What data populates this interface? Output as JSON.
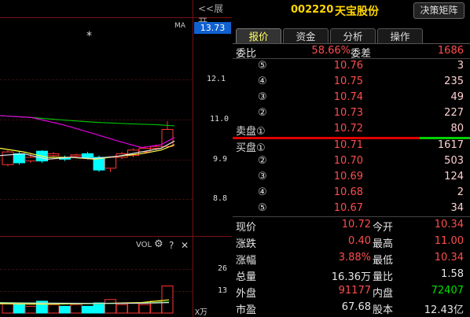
{
  "header": {
    "expand_label": "<<展开",
    "stock_code": "002220",
    "stock_name": "天宝股份",
    "decision_button": "决策矩阵"
  },
  "chart": {
    "ma_label": "MA",
    "current_price_tag": "13.73",
    "y_labels": [
      "12.1",
      "11.0",
      "9.9",
      "8.8"
    ],
    "star": "*",
    "vol_label": "VOL",
    "vol_gear_icon": "gear-icon",
    "vol_help": "?",
    "vol_close": "✕",
    "vol_y_labels": [
      "26",
      "13"
    ],
    "vol_unit": "X万",
    "candles": [
      {
        "o": 9.75,
        "c": 10.1,
        "h": 10.15,
        "l": 9.7,
        "up": true
      },
      {
        "o": 10.05,
        "c": 9.8,
        "h": 10.1,
        "l": 9.75,
        "up": false
      },
      {
        "o": 9.85,
        "c": 9.95,
        "h": 10.05,
        "l": 9.8,
        "up": true
      },
      {
        "o": 10.12,
        "c": 9.85,
        "h": 10.15,
        "l": 9.8,
        "up": false
      },
      {
        "o": 10.0,
        "c": 10.05,
        "h": 10.1,
        "l": 9.95,
        "up": true
      },
      {
        "o": 9.95,
        "c": 9.9,
        "h": 10.0,
        "l": 9.85,
        "up": false
      },
      {
        "o": 9.98,
        "c": 10.02,
        "h": 10.05,
        "l": 9.95,
        "up": true
      },
      {
        "o": 10.05,
        "c": 9.95,
        "h": 10.1,
        "l": 9.9,
        "up": false
      },
      {
        "o": 9.95,
        "c": 9.6,
        "h": 10.0,
        "l": 9.55,
        "up": false
      },
      {
        "o": 9.65,
        "c": 9.95,
        "h": 9.98,
        "l": 9.55,
        "up": true
      },
      {
        "o": 9.95,
        "c": 10.05,
        "h": 10.1,
        "l": 9.9,
        "up": true
      },
      {
        "o": 10.0,
        "c": 10.15,
        "h": 10.2,
        "l": 9.95,
        "up": true
      },
      {
        "o": 10.1,
        "c": 10.2,
        "h": 10.25,
        "l": 10.05,
        "up": true
      },
      {
        "o": 10.2,
        "c": 10.25,
        "h": 10.3,
        "l": 10.15,
        "up": true
      },
      {
        "o": 10.25,
        "c": 10.72,
        "h": 10.95,
        "l": 10.2,
        "up": true
      }
    ],
    "volumes": [
      {
        "v": 6,
        "up": true
      },
      {
        "v": 5,
        "up": false
      },
      {
        "v": 4,
        "up": true
      },
      {
        "v": 7,
        "up": false
      },
      {
        "v": 5,
        "up": true
      },
      {
        "v": 4,
        "up": false
      },
      {
        "v": 5,
        "up": true
      },
      {
        "v": 4,
        "up": false
      },
      {
        "v": 6,
        "up": false
      },
      {
        "v": 8,
        "up": true
      },
      {
        "v": 5,
        "up": true
      },
      {
        "v": 6,
        "up": true
      },
      {
        "v": 5,
        "up": true
      },
      {
        "v": 7,
        "up": true
      },
      {
        "v": 16,
        "up": true
      }
    ]
  },
  "tabs": [
    "报价",
    "资金",
    "分析",
    "操作"
  ],
  "weibi": {
    "label1": "委比",
    "value1": "58.66%",
    "label2": "委差",
    "value2": "1686"
  },
  "asks": [
    {
      "level": "⑤",
      "price": "10.76",
      "vol": "3"
    },
    {
      "level": "④",
      "price": "10.75",
      "vol": "235"
    },
    {
      "level": "③",
      "price": "10.74",
      "vol": "49"
    },
    {
      "level": "②",
      "price": "10.73",
      "vol": "227"
    },
    {
      "level": "卖盘①",
      "price": "10.72",
      "vol": "80"
    }
  ],
  "bids": [
    {
      "level": "买盘①",
      "price": "10.71",
      "vol": "1617"
    },
    {
      "level": "②",
      "price": "10.70",
      "vol": "503"
    },
    {
      "level": "③",
      "price": "10.69",
      "vol": "124"
    },
    {
      "level": "④",
      "price": "10.68",
      "vol": "2"
    },
    {
      "level": "⑤",
      "price": "10.67",
      "vol": "34"
    }
  ],
  "ratio_bar": {
    "sell_fraction": 0.8
  },
  "stats": [
    {
      "l1": "现价",
      "v1": "10.72",
      "c1": "red",
      "l2": "今开",
      "v2": "10.34",
      "c2": "red"
    },
    {
      "l1": "涨跌",
      "v1": "0.40",
      "c1": "red",
      "l2": "最高",
      "v2": "11.00",
      "c2": "red"
    },
    {
      "l1": "涨幅",
      "v1": "3.88%",
      "c1": "red",
      "l2": "最低",
      "v2": "10.34",
      "c2": "red"
    },
    {
      "l1": "总量",
      "v1": "16.36万",
      "c1": "white",
      "l2": "量比",
      "v2": "1.58",
      "c2": "white"
    },
    {
      "l1": "外盘",
      "v1": "91177",
      "c1": "red",
      "l2": "内盘",
      "v2": "72407",
      "c2": "green"
    },
    {
      "l1": "市盈",
      "v1": "67.68",
      "c1": "white",
      "l2": "股本",
      "v2": "12.43亿",
      "c2": "white"
    }
  ],
  "colors": {
    "up": "#ff3333",
    "down": "#00ffff",
    "ma_green": "#00c000",
    "ma_magenta": "#e000e0",
    "ma_yellow": "#ffff40",
    "ma_white": "#e0e0e0"
  }
}
